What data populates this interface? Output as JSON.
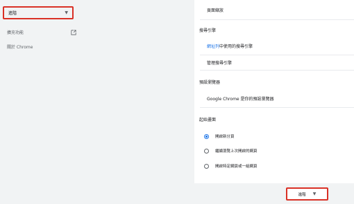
{
  "sidebar": {
    "advanced_label": "進階",
    "extensions_label": "擴充功能",
    "about_label": "關於 Chrome"
  },
  "appearance": {
    "page_zoom_label": "頁面縮放"
  },
  "search_engine": {
    "title": "搜尋引擎",
    "address_bar_link": "網址列",
    "address_bar_rest": "中使用的搜尋引擎",
    "manage_label": "管理搜尋引擎"
  },
  "default_browser": {
    "title": "預設瀏覽器",
    "status_text": "Google Chrome 是你的預設瀏覽器"
  },
  "on_startup": {
    "title": "起始畫面",
    "options": [
      {
        "label": "開啟新分頁",
        "checked": true
      },
      {
        "label": "繼續瀏覽上次開啟的網頁",
        "checked": false
      },
      {
        "label": "開啟特定網頁或一組網頁",
        "checked": false
      }
    ]
  },
  "advanced_button": {
    "label": "進階"
  },
  "colors": {
    "accent": "#1a73e8",
    "highlight": "#d93025"
  }
}
